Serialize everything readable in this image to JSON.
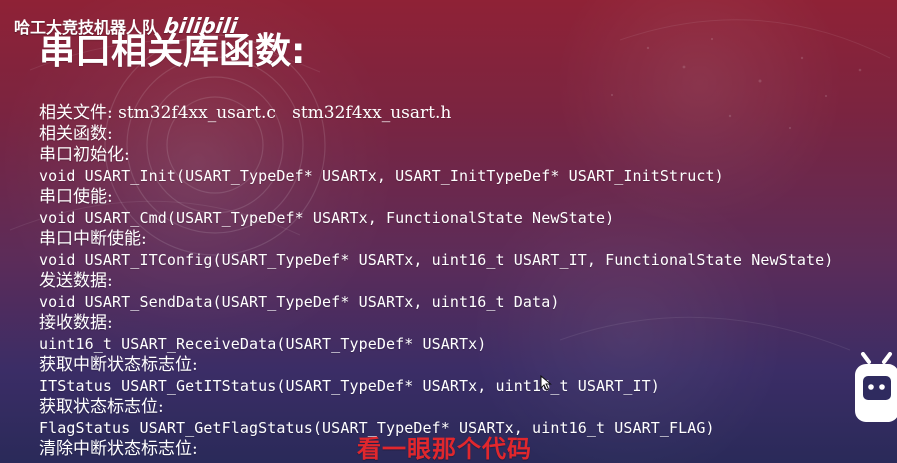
{
  "branding": {
    "team_name": "哈工大竞技机器人队",
    "platform_logo": "bilibili"
  },
  "slide": {
    "title": "串口相关库函数:",
    "lines": [
      {
        "kind": "cn",
        "text": "相关文件: stm32f4xx_usart.c   stm32f4xx_usart.h"
      },
      {
        "kind": "cn",
        "text": "相关函数:"
      },
      {
        "kind": "cn",
        "text": "串口初始化:"
      },
      {
        "kind": "code",
        "text": "void USART_Init(USART_TypeDef* USARTx, USART_InitTypeDef* USART_InitStruct)"
      },
      {
        "kind": "cn",
        "text": "串口使能:"
      },
      {
        "kind": "code",
        "text": "void USART_Cmd(USART_TypeDef* USARTx, FunctionalState NewState)"
      },
      {
        "kind": "cn",
        "text": "串口中断使能:"
      },
      {
        "kind": "code",
        "text": "void USART_ITConfig(USART_TypeDef* USARTx, uint16_t USART_IT, FunctionalState NewState)"
      },
      {
        "kind": "cn",
        "text": "发送数据:"
      },
      {
        "kind": "code",
        "text": "void USART_SendData(USART_TypeDef* USARTx, uint16_t Data)"
      },
      {
        "kind": "cn",
        "text": "接收数据:"
      },
      {
        "kind": "code",
        "text": "uint16_t USART_ReceiveData(USART_TypeDef* USARTx)"
      },
      {
        "kind": "cn",
        "text": "获取中断状态标志位:"
      },
      {
        "kind": "code",
        "text": "ITStatus USART_GetITStatus(USART_TypeDef* USARTx, uint16_t USART_IT)"
      },
      {
        "kind": "cn",
        "text": "获取状态标志位:"
      },
      {
        "kind": "code",
        "text": "FlagStatus USART_GetFlagStatus(USART_TypeDef* USARTx, uint16_t USART_FLAG)"
      },
      {
        "kind": "cn",
        "text": "清除中断状态标志位:"
      }
    ]
  },
  "overlay": {
    "caption": "看一眼那个代码"
  },
  "colors": {
    "accent_red": "#e1272d",
    "text_white": "#ffffff"
  },
  "icons": {
    "cursor": "mouse-pointer-icon",
    "tv": "bilibili-tv-icon"
  }
}
